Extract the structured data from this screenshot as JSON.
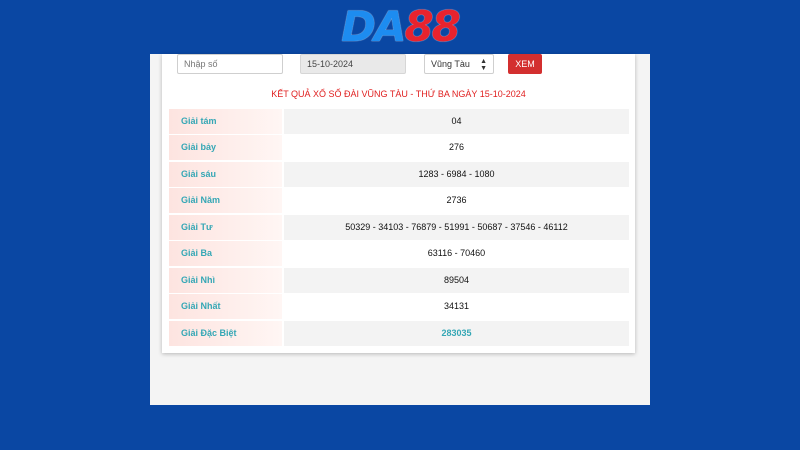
{
  "brand": {
    "logo_da": "DA",
    "logo_num": "88"
  },
  "search": {
    "placeholder": "Nhập số",
    "value": ""
  },
  "date": {
    "value": "15-10-2024"
  },
  "province_select": {
    "selected": "Vũng Tàu"
  },
  "view_button": {
    "label": "XEM"
  },
  "result_title": "KẾT QUẢ XỔ SỐ ĐÀI VŨNG TÀU - THỨ BA NGÀY 15-10-2024",
  "results": [
    {
      "label": "Giải tám",
      "value": "04"
    },
    {
      "label": "Giải bảy",
      "value": "276"
    },
    {
      "label": "Giải sáu",
      "value": "1283 - 6984 - 1080"
    },
    {
      "label": "Giải Năm",
      "value": "2736"
    },
    {
      "label": "Giải Tư",
      "value": "50329 - 34103 - 76879 - 51991 - 50687 - 37546 - 46112"
    },
    {
      "label": "Giải Ba",
      "value": "63116 - 70460"
    },
    {
      "label": "Giải Nhì",
      "value": "89504"
    },
    {
      "label": "Giải Nhất",
      "value": "34131"
    },
    {
      "label": "Giải Đặc Biệt",
      "value": "283035"
    }
  ],
  "colors": {
    "background": "#0a47a3",
    "accent": "#35a7b5",
    "button": "#d32f2f",
    "title": "#e02020"
  }
}
